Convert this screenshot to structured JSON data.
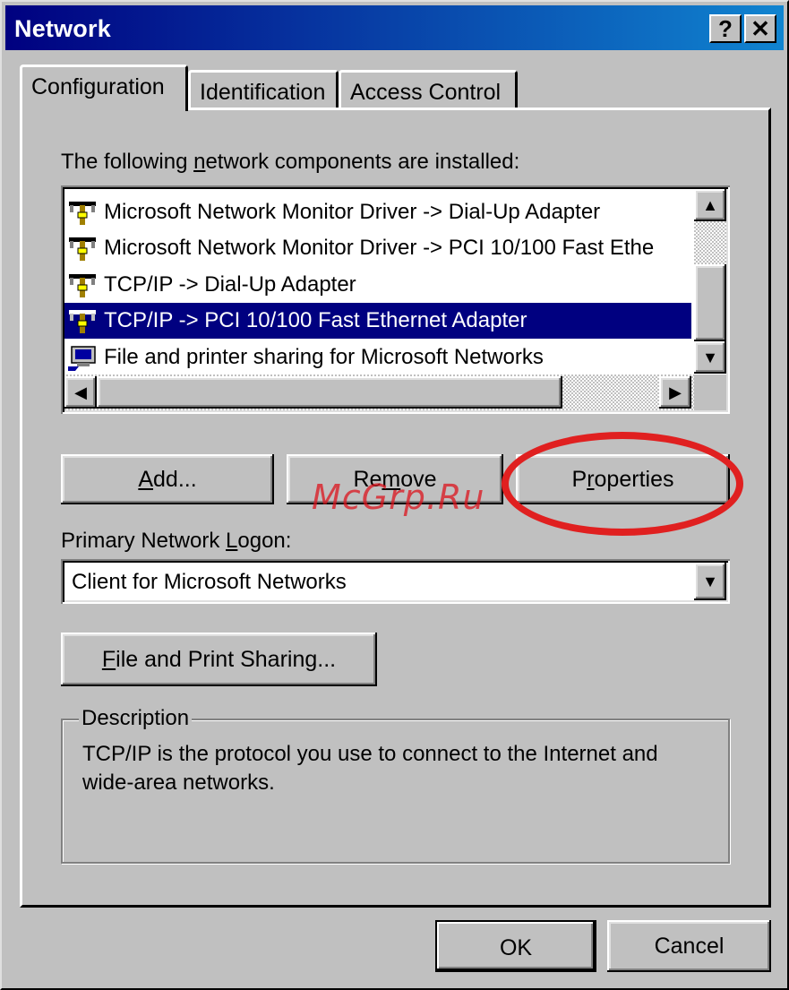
{
  "window": {
    "title": "Network",
    "help_glyph": "?",
    "close_glyph": "✕"
  },
  "tabs": [
    {
      "label": "Configuration",
      "active": true
    },
    {
      "label": "Identification",
      "active": false
    },
    {
      "label": "Access Control",
      "active": false
    }
  ],
  "components": {
    "label_pre": "The following ",
    "label_key": "n",
    "label_post": "etwork components are installed:",
    "items": [
      {
        "icon": "network-protocol-icon",
        "label": "Microsoft Network Monitor Driver -> Dial-Up Adapter",
        "selected": false
      },
      {
        "icon": "network-protocol-icon",
        "label": "Microsoft Network Monitor Driver -> PCI 10/100 Fast Ethe",
        "selected": false
      },
      {
        "icon": "network-protocol-icon",
        "label": "TCP/IP -> Dial-Up Adapter",
        "selected": false
      },
      {
        "icon": "network-protocol-icon",
        "label": "TCP/IP -> PCI 10/100 Fast Ethernet Adapter",
        "selected": true
      },
      {
        "icon": "computer-share-icon",
        "label": "File and printer sharing for Microsoft Networks",
        "selected": false
      }
    ]
  },
  "buttons": {
    "add": {
      "key": "A",
      "rest": "dd..."
    },
    "remove": {
      "pre": "Re",
      "key": "m",
      "rest": "ove"
    },
    "properties": {
      "pre": "P",
      "key": "r",
      "rest": "operties"
    },
    "file_print": {
      "key": "F",
      "rest": "ile and Print Sharing..."
    },
    "ok": "OK",
    "cancel": "Cancel"
  },
  "logon": {
    "label_pre": "Primary Network ",
    "label_key": "L",
    "label_post": "ogon:",
    "value": "Client for Microsoft Networks"
  },
  "description": {
    "legend": "Description",
    "text": "TCP/IP is the protocol you use to connect to the Internet and wide-area networks."
  },
  "watermark": "McGrp.Ru",
  "highlight_color": "#e02020"
}
